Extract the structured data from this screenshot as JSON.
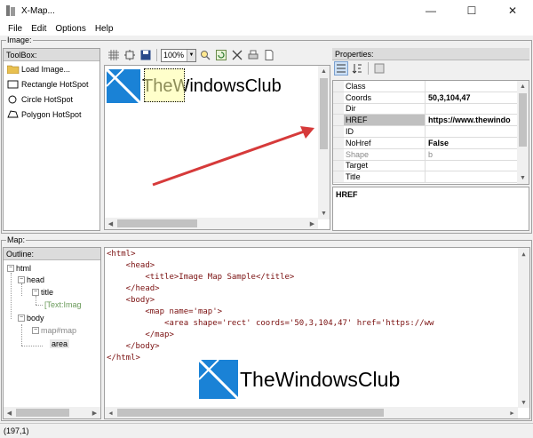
{
  "window": {
    "title": "X-Map...",
    "minimize": "—",
    "maximize": "☐",
    "close": "✕"
  },
  "menu": [
    "File",
    "Edit",
    "Options",
    "Help"
  ],
  "groups": {
    "image": "Image:",
    "map": "Map:"
  },
  "toolbox": {
    "header": "ToolBox:",
    "items": [
      "Load Image...",
      "Rectangle HotSpot",
      "Circle HotSpot",
      "Polygon HotSpot"
    ]
  },
  "image_toolbar": {
    "zoom": "100%"
  },
  "canvas": {
    "logo_text": "TheWindowsClub"
  },
  "properties": {
    "header": "Properties:",
    "rows": [
      {
        "name": "Class",
        "value": ""
      },
      {
        "name": "Coords",
        "value": "50,3,104,47"
      },
      {
        "name": "Dir",
        "value": ""
      },
      {
        "name": "HREF",
        "value": "https://www.thewindo"
      },
      {
        "name": "ID",
        "value": ""
      },
      {
        "name": "NoHref",
        "value": "False"
      },
      {
        "name": "Shape",
        "value": "b"
      },
      {
        "name": "Target",
        "value": ""
      },
      {
        "name": "Title",
        "value": ""
      }
    ],
    "description": "HREF"
  },
  "outline": {
    "header": "Outline:",
    "nodes": [
      "html",
      "head",
      "title",
      "[Text:Imag",
      "body",
      "map#map",
      "area"
    ]
  },
  "code": {
    "lines": [
      "<html>",
      "    <head>",
      "        <title>Image Map Sample</title>",
      "    </head>",
      "    <body>",
      "        <map name='map'>",
      "            <area shape='rect' coords='50,3,104,47' href='https://ww",
      "        </map>",
      "    </body>",
      "</html>"
    ],
    "logo_text": "TheWindowsClub"
  },
  "status": "(197,1)"
}
